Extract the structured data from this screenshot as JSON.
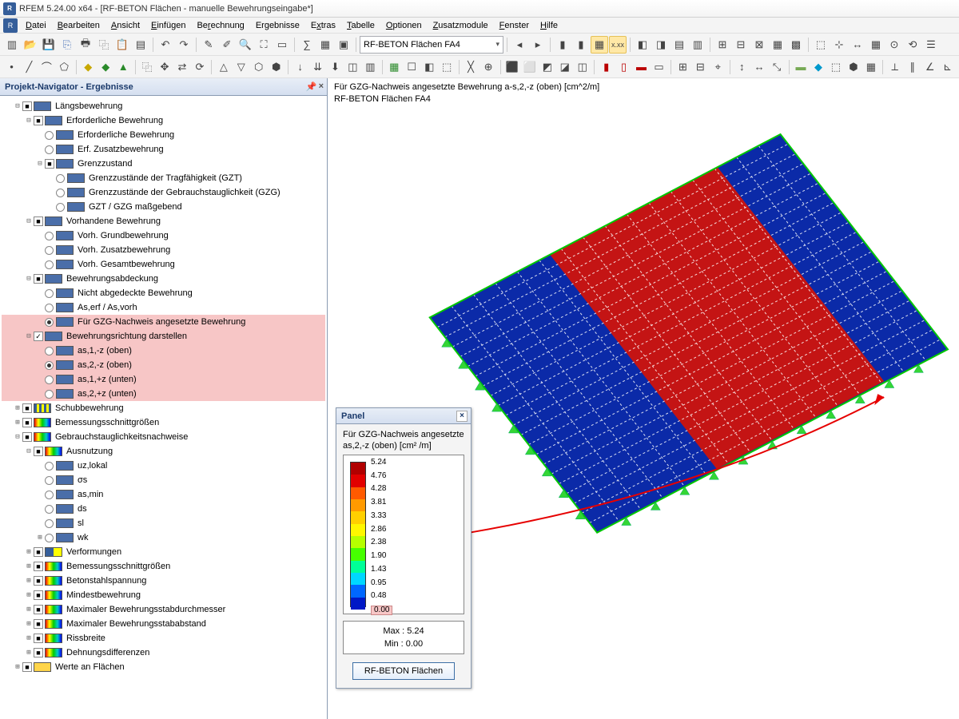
{
  "window": {
    "title": "RFEM 5.24.00 x64 - [RF-BETON Flächen - manuelle Bewehrungseingabe*]"
  },
  "menu": [
    "Datei",
    "Bearbeiten",
    "Ansicht",
    "Einfügen",
    "Berechnung",
    "Ergebnisse",
    "Extras",
    "Tabelle",
    "Optionen",
    "Zusatzmodule",
    "Fenster",
    "Hilfe"
  ],
  "combo1": "RF-BETON Flächen FA4",
  "navigator": {
    "title": "Projekt-Navigator - Ergebnisse"
  },
  "tree": {
    "n0": "Längsbewehrung",
    "n1": "Erforderliche Bewehrung",
    "n2": "Erforderliche Bewehrung",
    "n3": "Erf. Zusatzbewehrung",
    "n4": "Grenzzustand",
    "n5": "Grenzzustände der Tragfähigkeit (GZT)",
    "n6": "Grenzzustände der Gebrauchstauglichkeit (GZG)",
    "n7": "GZT / GZG maßgebend",
    "n8": "Vorhandene Bewehrung",
    "n9": "Vorh. Grundbewehrung",
    "n10": "Vorh. Zusatzbewehrung",
    "n11": "Vorh. Gesamtbewehrung",
    "n12": "Bewehrungsabdeckung",
    "n13": "Nicht abgedeckte Bewehrung",
    "n14": "As,erf / As,vorh",
    "n15": "Für GZG-Nachweis angesetzte Bewehrung",
    "n16": "Bewehrungsrichtung darstellen",
    "n17": "as,1,-z (oben)",
    "n18": "as,2,-z (oben)",
    "n19": "as,1,+z (unten)",
    "n20": "as,2,+z (unten)",
    "n21": "Schubbewehrung",
    "n22": "Bemessungsschnittgrößen",
    "n23": "Gebrauchstauglichkeitsnachweise",
    "n24": "Ausnutzung",
    "n25": "uz,lokal",
    "n26": "σs",
    "n27": "as,min",
    "n28": "ds",
    "n29": "sl",
    "n30": "wk",
    "n31": "Verformungen",
    "n32": "Bemessungsschnittgrößen",
    "n33": "Betonstahlspannung",
    "n34": "Mindestbewehrung",
    "n35": "Maximaler Bewehrungsstabdurchmesser",
    "n36": "Maximaler Bewehrungsstababstand",
    "n37": "Rissbreite",
    "n38": "Dehnungsdifferenzen",
    "n39": "Werte an Flächen"
  },
  "viewport": {
    "line1": "Für GZG-Nachweis angesetzte Bewehrung a-s,2,-z (oben) [cm^2/m]",
    "line2": "RF-BETON Flächen FA4"
  },
  "panel": {
    "hdr": "Panel",
    "title1": "Für GZG-Nachweis angesetzte",
    "title2": "as,2,-z (oben) [cm² /m]",
    "max": "Max  :  5.24",
    "min": "Min   :  0.00",
    "button": "RF-BETON Flächen"
  },
  "chart_data": {
    "type": "bar",
    "title": "Color scale a-s,2,-z (oben) [cm²/m]",
    "categories": [
      "5.24",
      "4.76",
      "4.28",
      "3.81",
      "3.33",
      "2.86",
      "2.38",
      "1.90",
      "1.43",
      "0.95",
      "0.48",
      "0.00"
    ],
    "values": [
      5.24,
      4.76,
      4.28,
      3.81,
      3.33,
      2.86,
      2.38,
      1.9,
      1.43,
      0.95,
      0.48,
      0.0
    ],
    "colors": [
      "#b10000",
      "#e20000",
      "#ff5a00",
      "#ff9a00",
      "#ffd000",
      "#fff700",
      "#b6ff00",
      "#46ff00",
      "#00ff97",
      "#00d7ff",
      "#0067ff",
      "#0018c6"
    ],
    "ylim": [
      0,
      5.24
    ]
  }
}
